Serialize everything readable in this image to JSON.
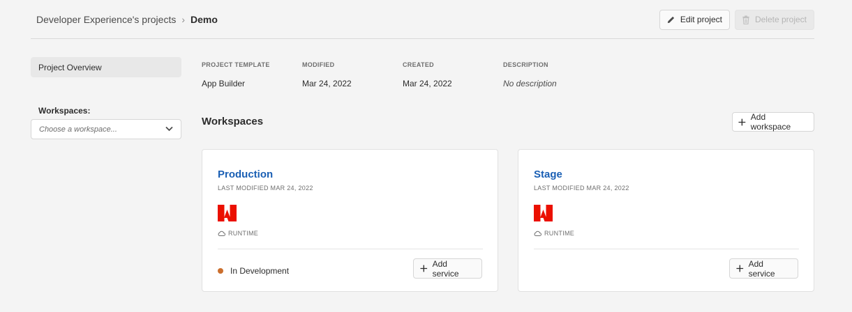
{
  "breadcrumb": {
    "parent": "Developer Experience's projects",
    "separator": "›",
    "current": "Demo"
  },
  "header_actions": {
    "edit_label": "Edit project",
    "delete_label": "Delete project"
  },
  "sidebar": {
    "overview_label": "Project Overview",
    "workspaces_label": "Workspaces:",
    "workspace_select_placeholder": "Choose a workspace..."
  },
  "meta": {
    "template_label": "PROJECT TEMPLATE",
    "template_value": "App Builder",
    "modified_label": "MODIFIED",
    "modified_value": "Mar 24, 2022",
    "created_label": "CREATED",
    "created_value": "Mar 24, 2022",
    "description_label": "DESCRIPTION",
    "description_value": "No description"
  },
  "workspaces": {
    "title": "Workspaces",
    "add_label": "Add workspace",
    "cards": [
      {
        "name": "Production",
        "subtitle": "LAST MODIFIED MAR 24, 2022",
        "runtime_label": "RUNTIME",
        "status": "In Development",
        "add_service_label": "Add service"
      },
      {
        "name": "Stage",
        "subtitle": "LAST MODIFIED MAR 24, 2022",
        "runtime_label": "RUNTIME",
        "add_service_label": "Add service"
      }
    ]
  },
  "colors": {
    "link": "#1a5fb4",
    "status_dot": "#cb6f2e",
    "adobe_red": "#eb1000"
  },
  "icons": [
    "pencil-icon",
    "trash-icon",
    "chevron-down-icon",
    "plus-icon",
    "cloud-icon",
    "adobe-logo-icon"
  ]
}
